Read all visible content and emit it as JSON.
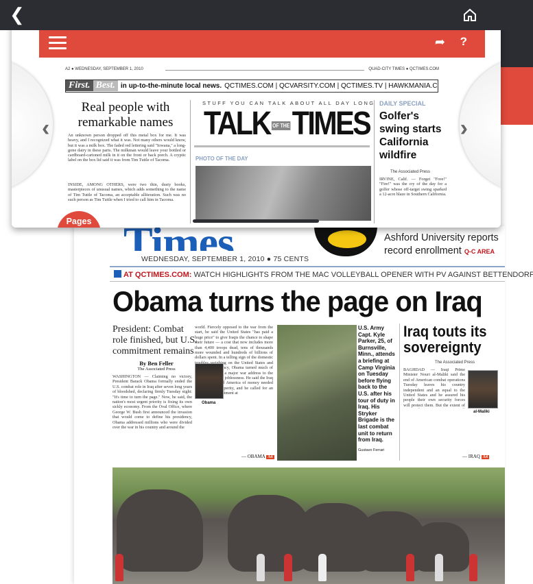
{
  "app": {
    "back_icon": "chevron-left-icon",
    "home_icon": "home-icon"
  },
  "back_page": {
    "masthead": "Times",
    "ashford_promo": "Ashford University reports record enrollment",
    "ashford_tag": "Q-C AREA",
    "dateline": "WEDNESDAY, SEPTEMBER 1, 2010 ● 75 CENTS",
    "promo_lead": "AT QCTIMES.COM:",
    "promo_text": "WATCH HIGHLIGHTS FROM THE MAC VOLLEYBALL OPENER WITH PV AGAINST BETTENDORF",
    "headline": "Obama turns the page on Iraq",
    "subhead": "President: Combat role finished, but U.S. commitment remains",
    "byline": "By Ben Feller",
    "byline_source": "The Associated Press",
    "col1_text": "WASHINGTON — Claiming no victory, President Barack Obama formally ended the U.S. combat role in Iraq after seven long years of bloodshed, declaring firmly Tuesday night: \"It's time to turn the page.\" Now, he said, the nation's most urgent priority is fixing its own sickly economy. From the Oval Office, where George W. Bush first announced the invasion that would come to define his presidency, Obama addressed millions who were divided over the war in his country and around the",
    "col2_text": "world. Fiercely opposed to the war from the start, he said the United States \"has paid a huge price\" to give Iraqis the chance to shape their future — a cost that now includes more than 4,400 troops dead, tens of thousands more wounded and hundreds of billions of dollars spent. In a telling sign of the domestic troubles weighing on the United States and his own presidency, Obama turned much of the emphasis in a major war address to the dire state of U.S. joblessness. He said the Iraq war had stripped America of money needed for its own prosperity, and he called for an economic commitment at",
    "obama_caption": "Obama",
    "obama_jump": "— OBAMA",
    "obama_jump_page": "A4",
    "photo_caption": "U.S. Army Capt. Kyle Parker, 25, of Burnsville, Minn., attends a briefing at Camp Virginia on Tuesday before flying back to the U.S. after his tour of duty in Iraq. His Stryker Brigade is the last combat unit to return from Iraq.",
    "photo_credit": "Gustavo Ferrari",
    "iraq_headline": "Iraq touts its sovereignty",
    "iraq_source": "The Associated Press",
    "iraq_text": "BAGHDAD — Iraqi Prime Minister Nouri al-Maliki said the end of American combat operations Tuesday leaves his country independent and an equal to the United States and he assured his people their own security forces will protect them. But the extent of U.S. influence in Iraq was still palpable. Vice President Joe Biden, presiding over the transition of the American role in Iraq, held a round of meetings with political leaders and pushed them to break a",
    "maliki_caption": "al-Maliki",
    "iraq_jump": "— IRAQ",
    "iraq_jump_page": "A4"
  },
  "viewer": {
    "menu_icon": "hamburger-menu-icon",
    "share_icon": "share-arrow-icon",
    "help_label": "?",
    "prev_label": "‹",
    "next_label": "›",
    "page_ref": "A2 ● WEDNESDAY, SEPTEMBER 1, 2010",
    "paper_ref": "QUAD-CITY TIMES ● QCTIMES.COM",
    "first_label": "First.",
    "best_label": "Best.",
    "first_text": "in up-to-the-minute local news.",
    "first_urls": "QCTIMES.COM | QCVARSITY.COM | QCTIMES.TV | HAWKMANIA.COM",
    "real_headline": "Real people with remarkable names",
    "real_text_1": "An unknown person dropped off this metal box for me. It was heavy, and I recognized what it was. Not many others would know, but it was a milk box. The faded red lettering said \"Iowana,\" a long-gone dairy in these parts. The milkman would leave your bottled or cardboard-cartoned milk in it on the front or back porch. A cryptic label on the box lid said it was from Tim Tuttle of Tacoma.",
    "real_text_2": "INSIDE, AMONG OTHERS, were two thin, dusty books, masterpieces of unusual names, which adds something to the name of Tim Tuttle of Tacoma, an acceptable alliteration. Such was no such person as Tim Tuttle when I tried to call him in Tacoma.",
    "stuff_line": "STUFF YOU CAN TALK ABOUT ALL DAY LONG",
    "talk_word": "TALK",
    "of_the": "OF THE",
    "times_word": "TIMES",
    "photo_of_day": "PHOTO OF THE DAY",
    "daily_special": "DAILY SPECIAL",
    "golf_headline": "Golfer's swing starts California wildfire",
    "golf_source": "The Associated Press",
    "golf_text": "IRVINE, Calif. — Forget \"Fore!\" \"Fire!\" was the cry of the day for a golfer whose off-target swing sparked a 12-acre blaze in Southern California.",
    "pages_button": "Pages"
  }
}
